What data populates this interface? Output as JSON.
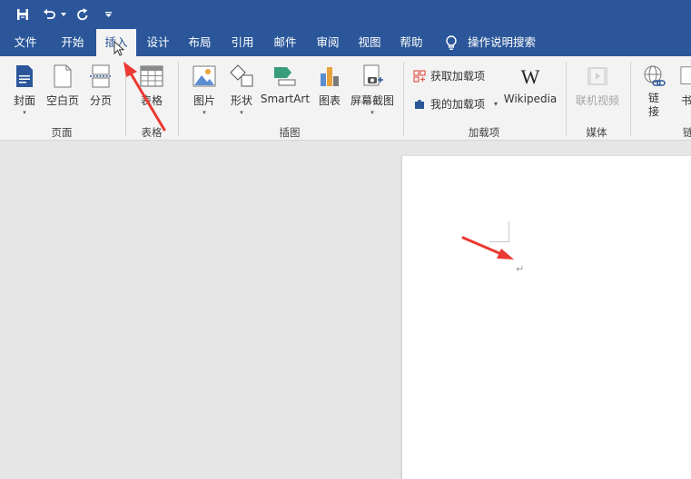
{
  "qat": {
    "save_icon": "save-icon",
    "undo_icon": "undo-icon",
    "redo_icon": "redo-icon",
    "customize_icon": "customize-icon"
  },
  "tabs": {
    "file": "文件",
    "home": "开始",
    "insert": "插入",
    "design": "设计",
    "layout": "布局",
    "references": "引用",
    "mailings": "邮件",
    "review": "审阅",
    "view": "视图",
    "help": "帮助",
    "tell_me": "操作说明搜索"
  },
  "ribbon": {
    "pages": {
      "label": "页面",
      "cover": "封面",
      "blank_page": "空白页",
      "page_break": "分页"
    },
    "tables": {
      "label": "表格",
      "table": "表格"
    },
    "illustrations": {
      "label": "插图",
      "pictures": "图片",
      "shapes": "形状",
      "smartart": "SmartArt",
      "chart": "图表",
      "screenshot": "屏幕截图"
    },
    "addins": {
      "label": "加载项",
      "get_addins": "获取加载项",
      "my_addins": "我的加载项",
      "wikipedia": "Wikipedia"
    },
    "media": {
      "label": "媒体",
      "online_video": "联机视频"
    },
    "links": {
      "link_line1": "链",
      "link_line2": "接",
      "bookmark": "书",
      "label_partial": "链"
    }
  },
  "document": {
    "paragraph_mark": "↵"
  },
  "colors": {
    "ribbon_blue": "#2b579a",
    "annotation_red": "#ea3a33"
  }
}
